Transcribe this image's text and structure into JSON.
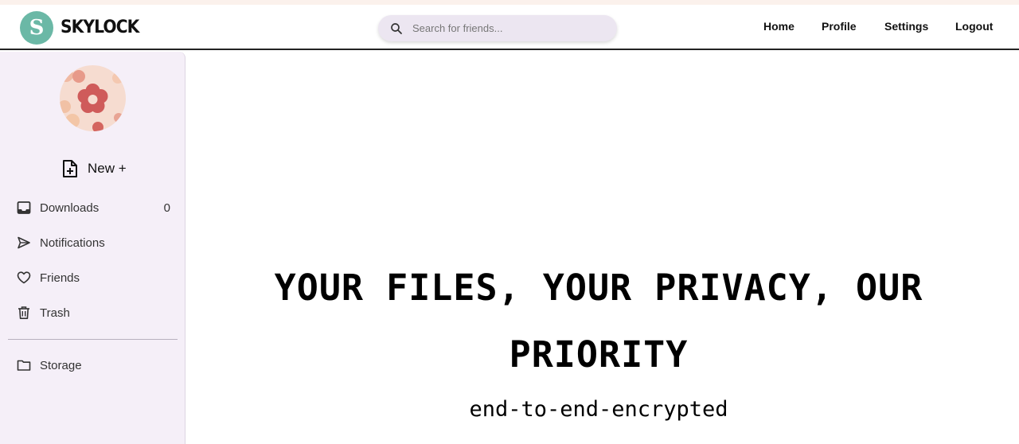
{
  "brand": {
    "badge_letter": "S",
    "name": "SKYLOCK",
    "color": "#6bb8a6"
  },
  "search": {
    "placeholder": "Search for friends...",
    "icon": "search-icon"
  },
  "nav": {
    "home": "Home",
    "profile": "Profile",
    "settings": "Settings",
    "logout": "Logout"
  },
  "sidebar": {
    "new_label": "New +",
    "items": [
      {
        "label": "Downloads",
        "icon": "inbox-icon",
        "count": "0"
      },
      {
        "label": "Notifications",
        "icon": "send-icon"
      },
      {
        "label": "Friends",
        "icon": "heart-icon"
      },
      {
        "label": "Trash",
        "icon": "trash-icon"
      },
      {
        "label": "Storage",
        "icon": "folder-icon"
      }
    ]
  },
  "hero": {
    "title": "YOUR FILES, YOUR PRIVACY, OUR PRIORITY",
    "subtitle": "end-to-end-encrypted"
  }
}
